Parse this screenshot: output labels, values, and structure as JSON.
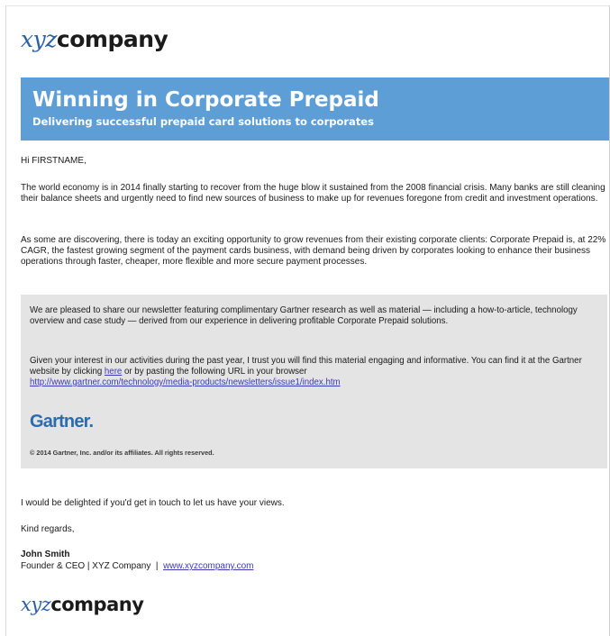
{
  "logo": {
    "xyz": "xyz",
    "company": "company"
  },
  "banner": {
    "title": "Winning in Corporate Prepaid",
    "subtitle": "Delivering successful prepaid card solutions to corporates"
  },
  "greeting": "Hi FIRSTNAME,",
  "paragraphs": [
    "The world economy is in 2014 finally starting to recover from the huge blow it sustained from the 2008 financial crisis. Many banks are still cleaning their balance sheets and urgently need to find new sources of business to make up for revenues foregone from credit and investment operations.",
    "As some are discovering, there is today an exciting opportunity to grow revenues from their existing corporate clients: Corporate Prepaid is, at 22% CAGR, the fastest growing segment of the payment cards business, with demand being driven by corporates looking to enhance their business operations through faster, cheaper, more flexible and more secure payment processes."
  ],
  "box": {
    "para1": "We are pleased to share our newsletter featuring complimentary Gartner research as well as material — including a how-to-article, technology overview and case study — derived from our experience in delivering profitable Corporate Prepaid solutions.",
    "para2_before_link": "Given your interest in our activities during the past year, I trust you will find this material engaging and informative. You can find it at the Gartner website by clicking ",
    "here_link": "here",
    "para2_after_link": " or by pasting the following URL in your browser",
    "url": "http://www.gartner.com/technology/media-products/newsletters/issue1/index.htm",
    "gartner_logo": "Gartner.",
    "copyright": "© 2014 Gartner, Inc. and/or its affiliates. All rights reserved."
  },
  "closing": "I would be delighted if you'd get in touch to let us have your views.",
  "regards": "Kind regards,",
  "signature": {
    "name": "John Smith",
    "title": "Founder & CEO | XYZ Company",
    "separator": "|",
    "website": "www.xyzcompany.com"
  },
  "colors": {
    "banner": "#5e9ed6",
    "logo_xyz": "#2b5fa8",
    "gartner": "#2a6cb0",
    "box_bg": "#e4e4e4",
    "link": "#3a3ab8"
  }
}
